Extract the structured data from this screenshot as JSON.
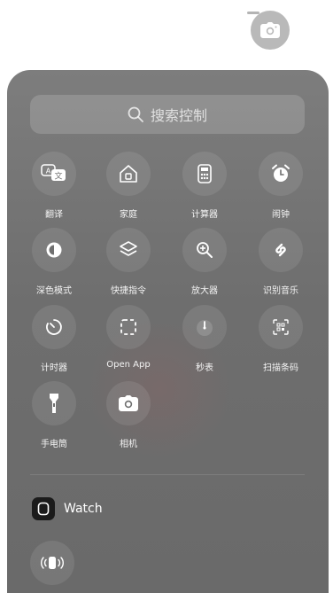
{
  "search": {
    "placeholder": "搜索控制"
  },
  "controls": [
    {
      "label": "翻译",
      "icon": "translate-icon"
    },
    {
      "label": "家庭",
      "icon": "home-icon"
    },
    {
      "label": "计算器",
      "icon": "calculator-icon"
    },
    {
      "label": "闹钟",
      "icon": "alarm-icon"
    },
    {
      "label": "深色模式",
      "icon": "dark-mode-icon"
    },
    {
      "label": "快捷指令",
      "icon": "shortcuts-icon"
    },
    {
      "label": "放大器",
      "icon": "magnifier-icon"
    },
    {
      "label": "识别音乐",
      "icon": "shazam-icon"
    },
    {
      "label": "计时器",
      "icon": "timer-icon"
    },
    {
      "label": "Open App",
      "icon": "open-app-icon"
    },
    {
      "label": "秒表",
      "icon": "stopwatch-icon"
    },
    {
      "label": "扫描条码",
      "icon": "barcode-scan-icon"
    },
    {
      "label": "手电筒",
      "icon": "flashlight-icon"
    },
    {
      "label": "相机",
      "icon": "camera-icon"
    }
  ],
  "watch_section": {
    "title": "Watch",
    "control_icon": "ping-watch-icon"
  },
  "colors": {
    "sheet": "#747474",
    "tile": "rgba(255,255,255,0.09)",
    "label": "#f3f3f3"
  }
}
